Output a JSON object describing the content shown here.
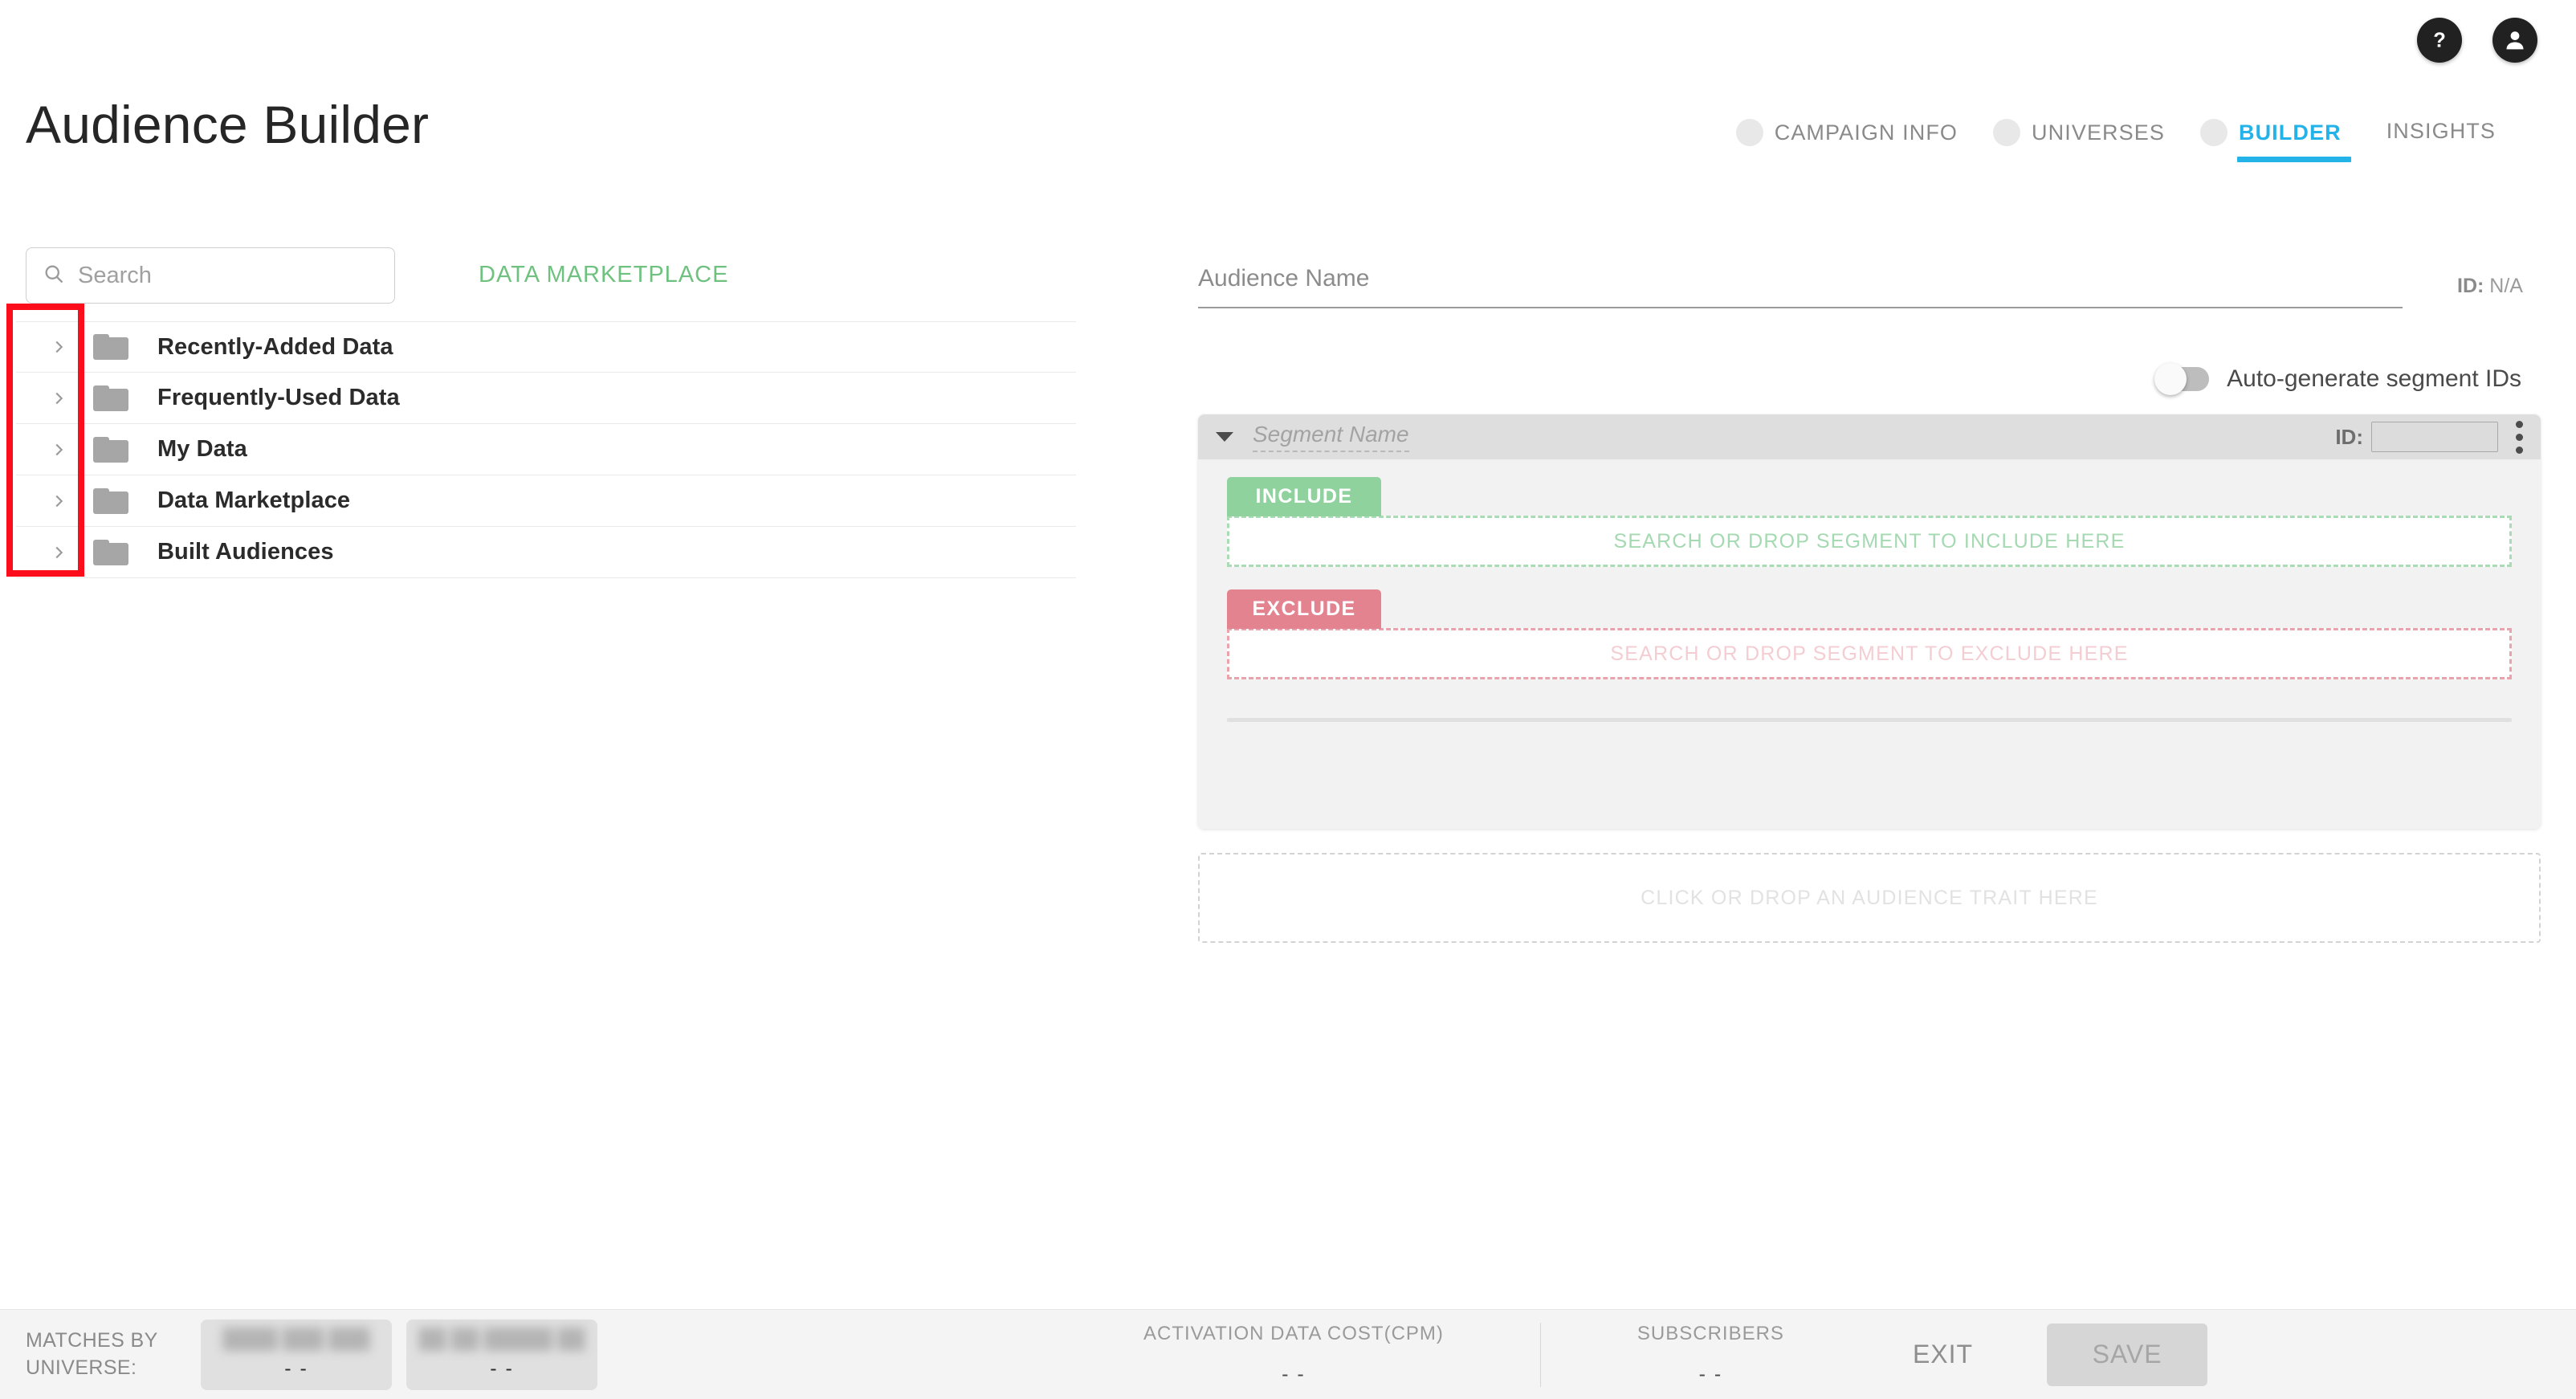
{
  "header": {
    "title": "Audience Builder",
    "help_icon": "help-icon",
    "account_icon": "account-icon"
  },
  "tabs": [
    {
      "label": "CAMPAIGN INFO",
      "active": false,
      "has_bullet": true
    },
    {
      "label": "UNIVERSES",
      "active": false,
      "has_bullet": true
    },
    {
      "label": "BUILDER",
      "active": true,
      "has_bullet": true
    },
    {
      "label": "INSIGHTS",
      "active": false,
      "has_bullet": false
    }
  ],
  "left_panel": {
    "search": {
      "value": "",
      "placeholder": "Search",
      "icon": "search-icon"
    },
    "marketplace_link": "DATA MARKETPLACE",
    "tree": [
      {
        "label": "Recently-Added Data",
        "expanded": false
      },
      {
        "label": "Frequently-Used Data",
        "expanded": false
      },
      {
        "label": "My Data",
        "expanded": false
      },
      {
        "label": "Data Marketplace",
        "expanded": false
      },
      {
        "label": "Built Audiences",
        "expanded": false
      }
    ]
  },
  "builder": {
    "audience_name_label": "Audience Name",
    "audience_name_value": "",
    "id_prefix": "ID:",
    "id_value": "N/A",
    "autogenerate": {
      "label": "Auto-generate segment IDs",
      "on": false
    },
    "segment": {
      "name_placeholder": "Segment Name",
      "name_value": "",
      "id_label": "ID:",
      "id_value": "",
      "menu_icon": "kebab-menu-icon",
      "collapse_icon": "caret-down-icon",
      "include": {
        "badge": "INCLUDE",
        "dropzone_text": "SEARCH OR DROP SEGMENT TO INCLUDE HERE"
      },
      "exclude": {
        "badge": "EXCLUDE",
        "dropzone_text": "SEARCH OR DROP SEGMENT TO EXCLUDE HERE"
      }
    },
    "trait_drop_text": "CLICK OR DROP AN AUDIENCE TRAIT HERE"
  },
  "bottom_bar": {
    "matches_label": "MATCHES BY UNIVERSE:",
    "universes": [
      {
        "title": "████ ███ ███",
        "value": "- -"
      },
      {
        "title": "██ ██ █████ ██",
        "value": "- -"
      }
    ],
    "metrics": [
      {
        "label": "ACTIVATION DATA COST(CPM)",
        "value": "- -"
      },
      {
        "label": "SUBSCRIBERS",
        "value": "- -"
      }
    ],
    "exit_label": "EXIT",
    "save_label": "SAVE"
  },
  "colors": {
    "accent_blue": "#24b3e8",
    "marketplace_green": "#6fc17f",
    "include_green": "#8fd29e",
    "exclude_red": "#e3838f",
    "annotation_red": "#fc0d1b"
  }
}
